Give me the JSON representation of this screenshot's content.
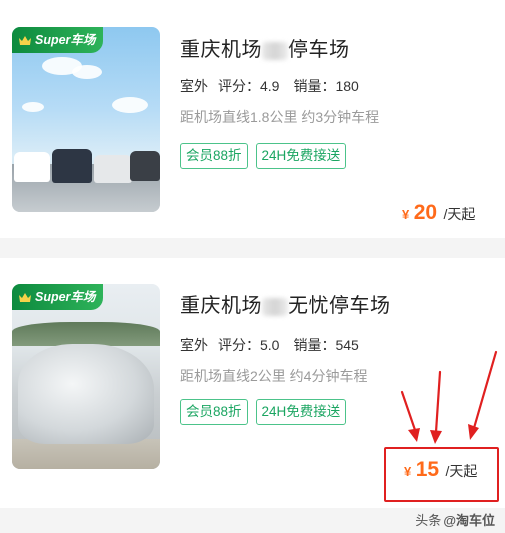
{
  "listings": [
    {
      "badge": "Super车场",
      "title_left": "重庆机场",
      "title_right": "停车场",
      "environment": "室外",
      "rating_label": "评分：",
      "rating": "4.9",
      "sales_label": "销量：",
      "sales": "180",
      "distance": "距机场直线1.8公里 约3分钟车程",
      "tags": [
        "会员88折",
        "24H免费接送"
      ],
      "currency": "¥",
      "price": "20",
      "price_unit": "/天起"
    },
    {
      "badge": "Super车场",
      "title_left": "重庆机场",
      "title_right": "无忧停车场",
      "environment": "室外",
      "rating_label": "评分：",
      "rating": "5.0",
      "sales_label": "销量：",
      "sales": "545",
      "distance": "距机场直线2公里 约4分钟车程",
      "tags": [
        "会员88折",
        "24H免费接送"
      ],
      "currency": "¥",
      "price": "15",
      "price_unit": "/天起"
    }
  ],
  "watermark": {
    "prefix": "头条",
    "handle": "@淘车位"
  },
  "colors": {
    "accent_green": "#1aa561",
    "price_orange": "#ff6a1a",
    "annotation_red": "#e02020"
  }
}
